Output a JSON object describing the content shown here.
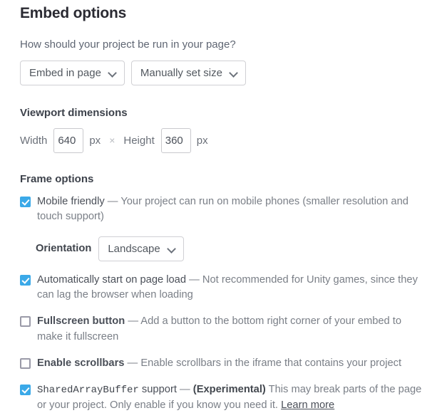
{
  "header": {
    "title": "Embed options",
    "prompt": "How should your project be run in your page?"
  },
  "embed_selects": [
    {
      "name": "embed-mode-select",
      "value": "Embed in page",
      "icon": "chevron-down-icon"
    },
    {
      "name": "size-mode-select",
      "value": "Manually set size",
      "icon": "chevron-down-icon"
    }
  ],
  "viewport": {
    "section_title": "Viewport dimensions",
    "width_label": "Width",
    "width_value": "640",
    "width_unit": "px",
    "separator": "×",
    "height_label": "Height",
    "height_value": "360",
    "height_unit": "px"
  },
  "frame": {
    "section_title": "Frame options",
    "orientation": {
      "label": "Orientation",
      "value": "Landscape",
      "icon": "chevron-down-icon"
    },
    "options": [
      {
        "id": "mobile-friendly",
        "checked": true,
        "label": "Mobile friendly",
        "label_style": "normal",
        "dash": "—",
        "description": "Your project can run on mobile phones (smaller resolution and touch support)"
      },
      {
        "id": "auto-start",
        "checked": true,
        "label": "Automatically start on page load",
        "label_style": "normal",
        "dash": "—",
        "description": "Not recommended for Unity games, since they can lag the browser when loading"
      },
      {
        "id": "fullscreen-button",
        "checked": false,
        "label": "Fullscreen button",
        "label_style": "bold",
        "dash": "—",
        "description": "Add a button to the bottom right corner of your embed to make it fullscreen"
      },
      {
        "id": "enable-scrollbars",
        "checked": false,
        "label": "Enable scrollbars",
        "label_style": "bold",
        "dash": "—",
        "description": "Enable scrollbars in the iframe that contains your project"
      },
      {
        "id": "sharedarraybuffer",
        "checked": true,
        "label": "SharedArrayBuffer",
        "label_suffix": " support",
        "label_style": "mono",
        "dash": "—",
        "emphasis": "(Experimental)",
        "description": " This may break parts of the page or your project. Only enable if you know you need it. ",
        "link": "Learn more"
      }
    ]
  },
  "colors": {
    "checkbox_checked": "#3ba9e8",
    "checkbox_border": "#9a9aa8",
    "heading": "#2a2a32",
    "body_text": "#6f747c"
  }
}
